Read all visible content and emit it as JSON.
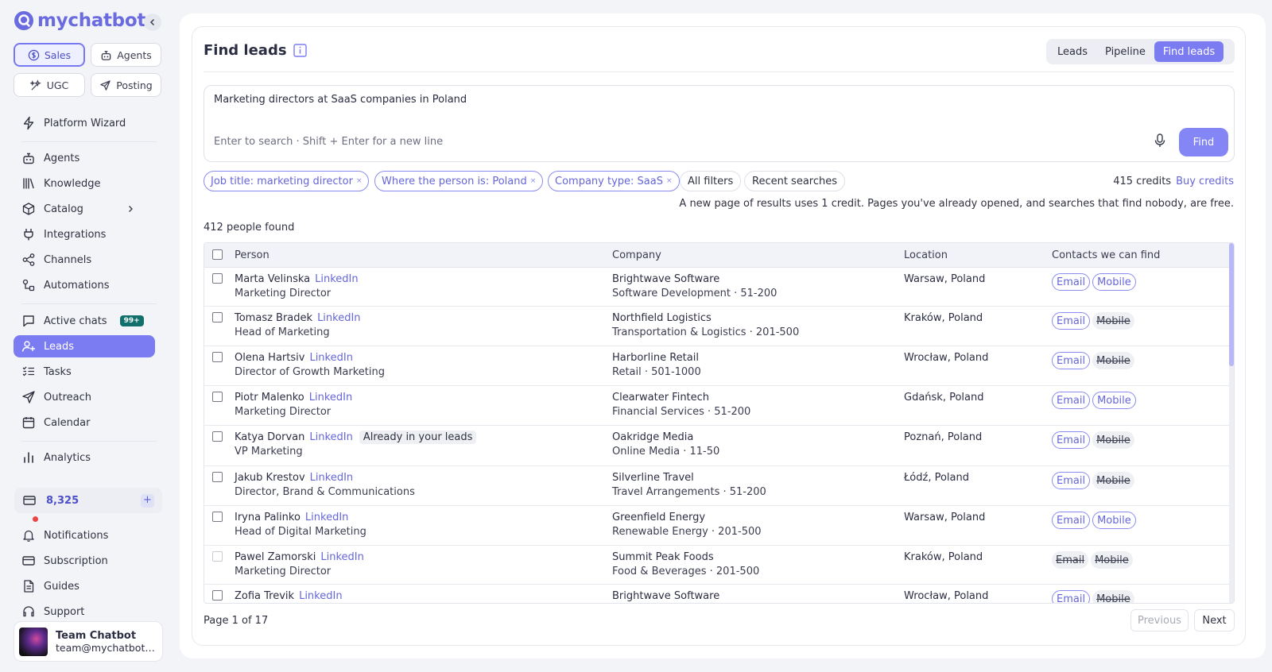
{
  "app": {
    "brand": "mychatbot"
  },
  "sidebar": {
    "modes": [
      {
        "label": "Sales",
        "icon": "dollar-icon",
        "active": true
      },
      {
        "label": "Agents",
        "icon": "robot-icon",
        "active": false
      },
      {
        "label": "UGC",
        "icon": "sparkle-icon",
        "active": false
      },
      {
        "label": "Posting",
        "icon": "send-icon",
        "active": false
      }
    ],
    "nav": [
      {
        "label": "Platform Wizard",
        "icon": "bolt-icon"
      },
      {
        "label": "Agents",
        "icon": "robot-icon"
      },
      {
        "label": "Knowledge",
        "icon": "books-icon"
      },
      {
        "label": "Catalog",
        "icon": "box-icon"
      },
      {
        "label": "Integrations",
        "icon": "plug-icon"
      },
      {
        "label": "Channels",
        "icon": "share-icon"
      },
      {
        "label": "Automations",
        "icon": "automation-icon"
      },
      {
        "label": "Active chats",
        "icon": "chat-icon",
        "badge": "99+"
      },
      {
        "label": "Leads",
        "icon": "user-plus-icon",
        "active": true
      },
      {
        "label": "Tasks",
        "icon": "tasks-icon"
      },
      {
        "label": "Outreach",
        "icon": "send-icon"
      },
      {
        "label": "Calendar",
        "icon": "calendar-icon"
      },
      {
        "label": "Analytics",
        "icon": "bar-chart-icon"
      }
    ],
    "credits": "8,325",
    "credits_plus": "+",
    "bottom": [
      {
        "label": "Notifications",
        "icon": "bell-icon"
      },
      {
        "label": "Subscription",
        "icon": "card-icon"
      },
      {
        "label": "Guides",
        "icon": "document-icon"
      },
      {
        "label": "Support",
        "icon": "headset-icon"
      }
    ],
    "user": {
      "name": "Team Chatbot",
      "email": "team@mychatbot.com"
    }
  },
  "main": {
    "title": "Find leads",
    "tabs": [
      {
        "label": "Leads",
        "active": false
      },
      {
        "label": "Pipeline",
        "active": false
      },
      {
        "label": "Find leads",
        "active": true
      }
    ],
    "search": {
      "query": "Marketing directors at SaaS companies in Poland",
      "hint": "Enter to search · Shift + Enter for a new line",
      "find_label": "Find"
    },
    "filters": [
      {
        "label": "Job title: marketing director",
        "remove": "×"
      },
      {
        "label": "Where the person is: Poland",
        "remove": "×"
      },
      {
        "label": "Company type: SaaS",
        "remove": "×"
      }
    ],
    "all_filters": "All filters",
    "recent_searches": "Recent searches",
    "credits": "415 credits",
    "buy_credits": "Buy credits",
    "credit_note": "A new page of results uses 1 credit. Pages you've already opened, and searches that find nobody, are free.",
    "found": "412 people found",
    "columns": {
      "person": "Person",
      "company": "Company",
      "location": "Location",
      "contacts": "Contacts we can find"
    },
    "rows": [
      {
        "name": "Marta Velinska",
        "linkedin": "LinkedIn",
        "title": "Marketing Director",
        "company": "Brightwave Software",
        "industry": "Software Development · 51-200",
        "location": "Warsaw, Poland",
        "email": "Email",
        "mobile": "Mobile",
        "email_ok": true,
        "mobile_ok": true
      },
      {
        "name": "Tomasz Bradek",
        "linkedin": "LinkedIn",
        "title": "Head of Marketing",
        "company": "Northfield Logistics",
        "industry": "Transportation & Logistics · 201-500",
        "location": "Kraków, Poland",
        "email": "Email",
        "mobile": "Mobile",
        "email_ok": true,
        "mobile_ok": false
      },
      {
        "name": "Olena Hartsiv",
        "linkedin": "LinkedIn",
        "title": "Director of Growth Marketing",
        "company": "Harborline Retail",
        "industry": "Retail · 501-1000",
        "location": "Wrocław, Poland",
        "email": "Email",
        "mobile": "Mobile",
        "email_ok": true,
        "mobile_ok": false
      },
      {
        "name": "Piotr Malenko",
        "linkedin": "LinkedIn",
        "title": "Marketing Director",
        "company": "Clearwater Fintech",
        "industry": "Financial Services · 51-200",
        "location": "Gdańsk, Poland",
        "email": "Email",
        "mobile": "Mobile",
        "email_ok": true,
        "mobile_ok": true
      },
      {
        "name": "Katya Dorvan",
        "linkedin": "LinkedIn",
        "tag": "Already in your leads",
        "title": "VP Marketing",
        "company": "Oakridge Media",
        "industry": "Online Media · 11-50",
        "location": "Poznań, Poland",
        "email": "Email",
        "mobile": "Mobile",
        "email_ok": true,
        "mobile_ok": false
      },
      {
        "name": "Jakub Krestov",
        "linkedin": "LinkedIn",
        "title": "Director, Brand & Communications",
        "company": "Silverline Travel",
        "industry": "Travel Arrangements · 51-200",
        "location": "Łódź, Poland",
        "email": "Email",
        "mobile": "Mobile",
        "email_ok": true,
        "mobile_ok": false
      },
      {
        "name": "Iryna Palinko",
        "linkedin": "LinkedIn",
        "title": "Head of Digital Marketing",
        "company": "Greenfield Energy",
        "industry": "Renewable Energy · 201-500",
        "location": "Warsaw, Poland",
        "email": "Email",
        "mobile": "Mobile",
        "email_ok": true,
        "mobile_ok": true
      },
      {
        "name": "Pawel Zamorski",
        "linkedin": "LinkedIn",
        "title": "Marketing Director",
        "company": "Summit Peak Foods",
        "industry": "Food & Beverages · 201-500",
        "location": "Kraków, Poland",
        "email": "Email",
        "mobile": "Mobile",
        "email_ok": false,
        "mobile_ok": false
      },
      {
        "name": "Zofia Trevik",
        "linkedin": "LinkedIn",
        "title": "",
        "company": "Brightwave Software",
        "industry": "",
        "location": "Wrocław, Poland",
        "email": "Email",
        "mobile": "Mobile",
        "email_ok": true,
        "mobile_ok": false
      }
    ],
    "pagination": {
      "info": "Page 1 of 17",
      "previous": "Previous",
      "next": "Next"
    }
  },
  "colors": {
    "accent": "#7b7cf2",
    "accent_text": "#6566d9",
    "badge": "#11706b",
    "notification": "#ef4444"
  }
}
